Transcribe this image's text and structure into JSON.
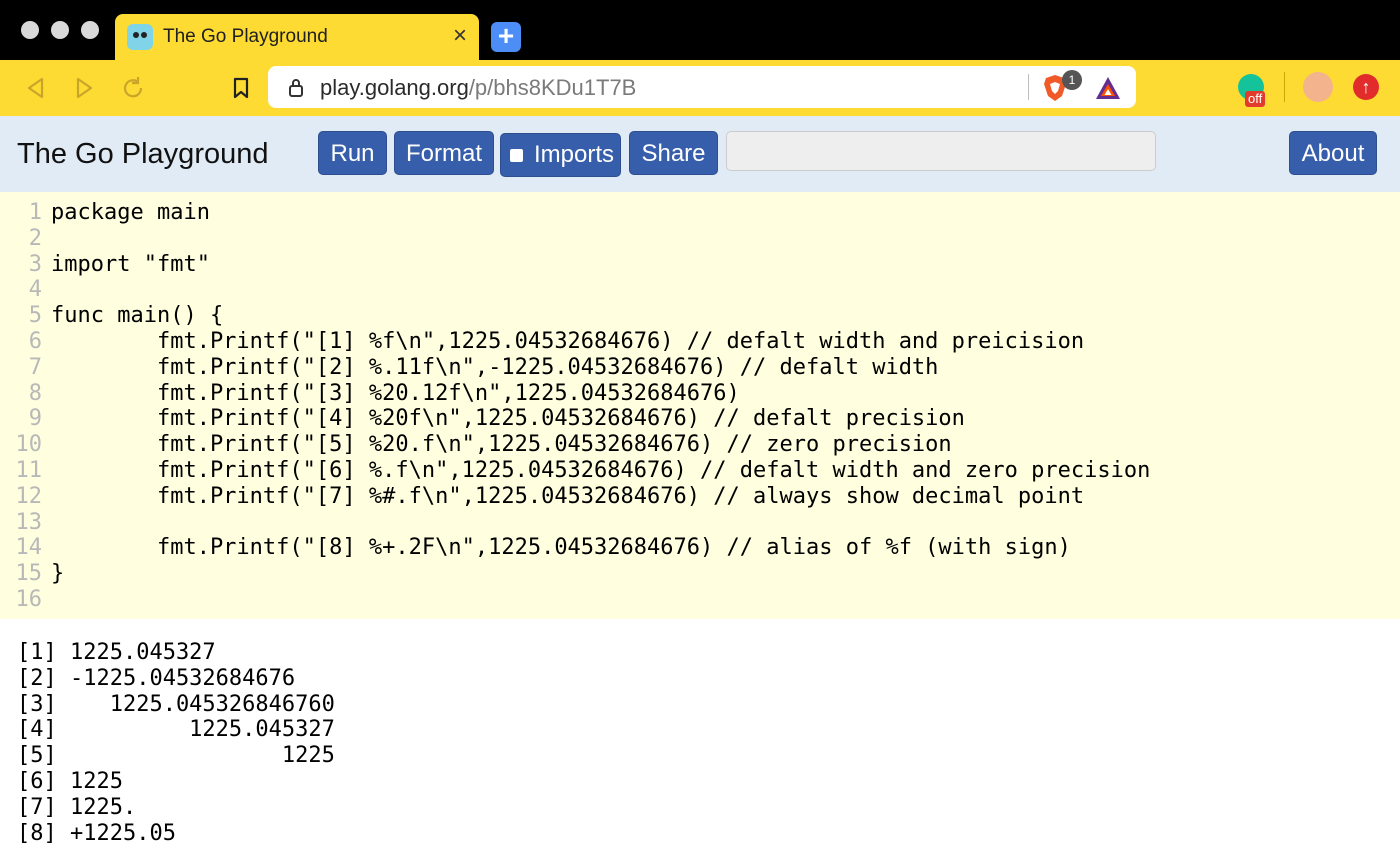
{
  "browser": {
    "tab_title": "The Go Playground",
    "tab_close": "×",
    "new_tab": "+",
    "url_host": "play.golang.org",
    "url_path": "/p/bhs8KDu1T7B",
    "brave_badge": "1",
    "grammarly_status": "off"
  },
  "header": {
    "title": "The Go Playground",
    "run_label": "Run",
    "format_label": "Format",
    "imports_label": "Imports",
    "share_label": "Share",
    "about_label": "About",
    "share_url_value": ""
  },
  "editor": {
    "line_numbers": "1\n2\n3\n4\n5\n6\n7\n8\n9\n10\n11\n12\n13\n14\n15\n16",
    "code": "package main\n\nimport \"fmt\"\n\nfunc main() {\n        fmt.Printf(\"[1] %f\\n\",1225.04532684676) // defalt width and preicision\n        fmt.Printf(\"[2] %.11f\\n\",-1225.04532684676) // defalt width\n        fmt.Printf(\"[3] %20.12f\\n\",1225.04532684676)\n        fmt.Printf(\"[4] %20f\\n\",1225.04532684676) // defalt precision\n        fmt.Printf(\"[5] %20.f\\n\",1225.04532684676) // zero precision\n        fmt.Printf(\"[6] %.f\\n\",1225.04532684676) // defalt width and zero precision\n        fmt.Printf(\"[7] %#.f\\n\",1225.04532684676) // always show decimal point\n\n        fmt.Printf(\"[8] %+.2F\\n\",1225.04532684676) // alias of %f (with sign)\n}\n"
  },
  "output": {
    "text": "[1] 1225.045327\n[2] -1225.04532684676\n[3]    1225.045326846760\n[4]          1225.045327\n[5]                 1225\n[6] 1225\n[7] 1225.\n[8] +1225.05"
  },
  "colors": {
    "chrome_yellow": "#fddb33",
    "header_bg": "#e0ebf5",
    "button_blue": "#375eab",
    "editor_bg": "#ffffe0"
  }
}
